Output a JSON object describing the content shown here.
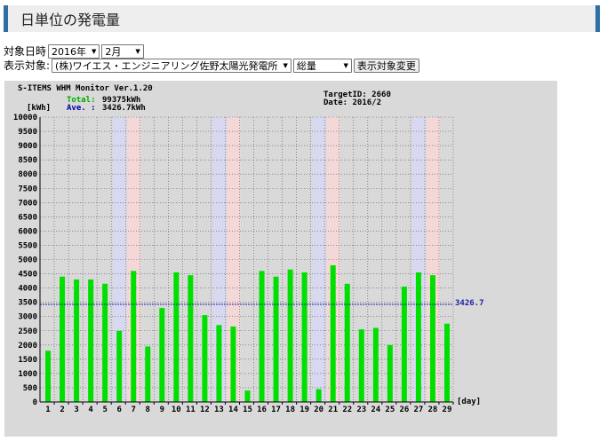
{
  "header": {
    "title": "日単位の発電量"
  },
  "controls": {
    "date_label": "対象日時",
    "year_value": "2016年",
    "month_value": "2月",
    "target_label": "表示対象:",
    "target_value": "(株)ワイエス・エンジニアリング佐野太陽光発電所",
    "type_value": "総量",
    "change_button": "表示対象変更"
  },
  "colors": {
    "bar": "#00e000",
    "saturday": "#d8d8f0",
    "sunday": "#f4d8d8",
    "average_line": "#2020a0",
    "total_text": "#00aa00",
    "ave_text": "#0000aa"
  },
  "chart_data": {
    "type": "bar",
    "title": "S-ITEMS WHM Monitor Ver.1.20",
    "target_id": "TargetID: 2660",
    "date_text": "Date: 2016/2",
    "total_label": "Total:",
    "total_value": "99375kWh",
    "ave_label": "Ave. :",
    "ave_value": "3426.7kWh",
    "average": 3426.7,
    "average_label": "3426.7",
    "ylabel": "[kWh]",
    "xlabel": "[day]",
    "ylim": [
      0,
      10000
    ],
    "yticks": [
      "0",
      "500",
      "1000",
      "1500",
      "2000",
      "2500",
      "3000",
      "3500",
      "4000",
      "4500",
      "5000",
      "5500",
      "6000",
      "6500",
      "7000",
      "7500",
      "8000",
      "8500",
      "9000",
      "9500",
      "10000"
    ],
    "categories": [
      "1",
      "2",
      "3",
      "4",
      "5",
      "6",
      "7",
      "8",
      "9",
      "10",
      "11",
      "12",
      "13",
      "14",
      "15",
      "16",
      "17",
      "18",
      "19",
      "20",
      "21",
      "22",
      "23",
      "24",
      "25",
      "26",
      "27",
      "28",
      "29"
    ],
    "values": [
      1800,
      4400,
      4300,
      4300,
      4150,
      2500,
      4600,
      1950,
      3300,
      4550,
      4450,
      3050,
      2700,
      2650,
      400,
      4600,
      4400,
      4650,
      4550,
      450,
      4800,
      4150,
      2550,
      2600,
      2000,
      4050,
      4550,
      4450,
      2750
    ],
    "saturdays": [
      6,
      13,
      20,
      27
    ],
    "sundays": [
      7,
      14,
      21,
      28
    ],
    "grid": true
  }
}
